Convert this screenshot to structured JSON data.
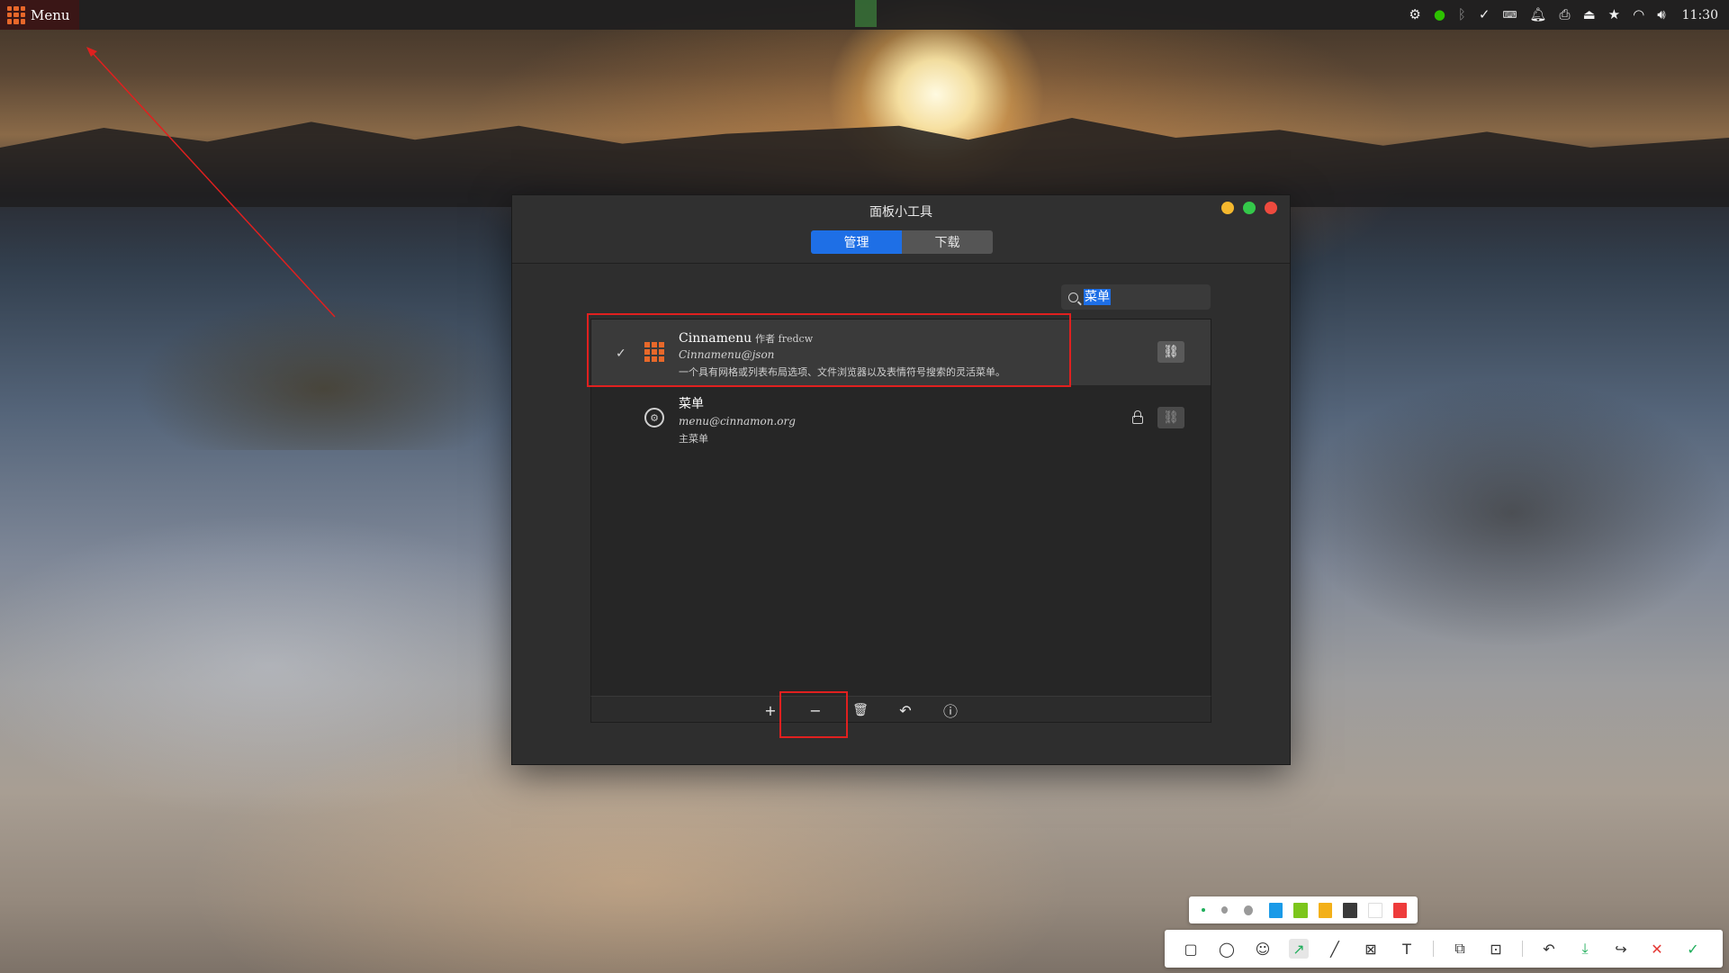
{
  "panel": {
    "menu_label": "Menu",
    "clock": "11:30",
    "tray_icons": [
      "network-settings-icon",
      "wechat-icon",
      "bluetooth-icon",
      "check-circle-icon",
      "keyboard-layout-icon",
      "notifications-icon",
      "printer-icon",
      "drive-icon",
      "favorites-star-icon",
      "wifi-icon",
      "volume-icon"
    ]
  },
  "window": {
    "title": "面板小工具",
    "tabs": [
      {
        "label": "管理",
        "active": true
      },
      {
        "label": "下载",
        "active": false
      }
    ],
    "search": {
      "value": "菜单"
    },
    "applets": [
      {
        "name": "Cinnamenu",
        "author": "作者 fredcw",
        "uuid": "Cinnamenu@json",
        "description": "一个具有网格或列表布局选项、文件浏览器以及表情符号搜索的灵活菜单。",
        "enabled": true,
        "icon": "cinnamenu-grid-icon",
        "locked": false,
        "selected": true
      },
      {
        "name": "菜单",
        "author": "",
        "uuid": "menu@cinnamon.org",
        "description": "主菜单",
        "enabled": false,
        "icon": "cinnamon-logo-icon",
        "locked": true,
        "selected": false
      }
    ],
    "toolbar": {
      "add": "+",
      "remove": "−",
      "delete": "🗑",
      "undo": "↶",
      "info": "ⓘ"
    }
  },
  "screenshot_tool": {
    "colors": [
      "#1a9ae8",
      "#7cc61b",
      "#f3b019",
      "#3a3a3a",
      "#ffffff",
      "#ee3b3b"
    ],
    "tools": [
      "rectangle-icon",
      "ellipse-icon",
      "emoji-icon",
      "arrow-icon",
      "line-icon",
      "mosaic-icon",
      "text-icon",
      "translate-icon",
      "ocr-icon",
      "undo-icon",
      "save-icon",
      "share-icon",
      "cancel-icon",
      "confirm-icon"
    ],
    "active_tool": "arrow-icon"
  },
  "annotation_color": "#e0201f"
}
